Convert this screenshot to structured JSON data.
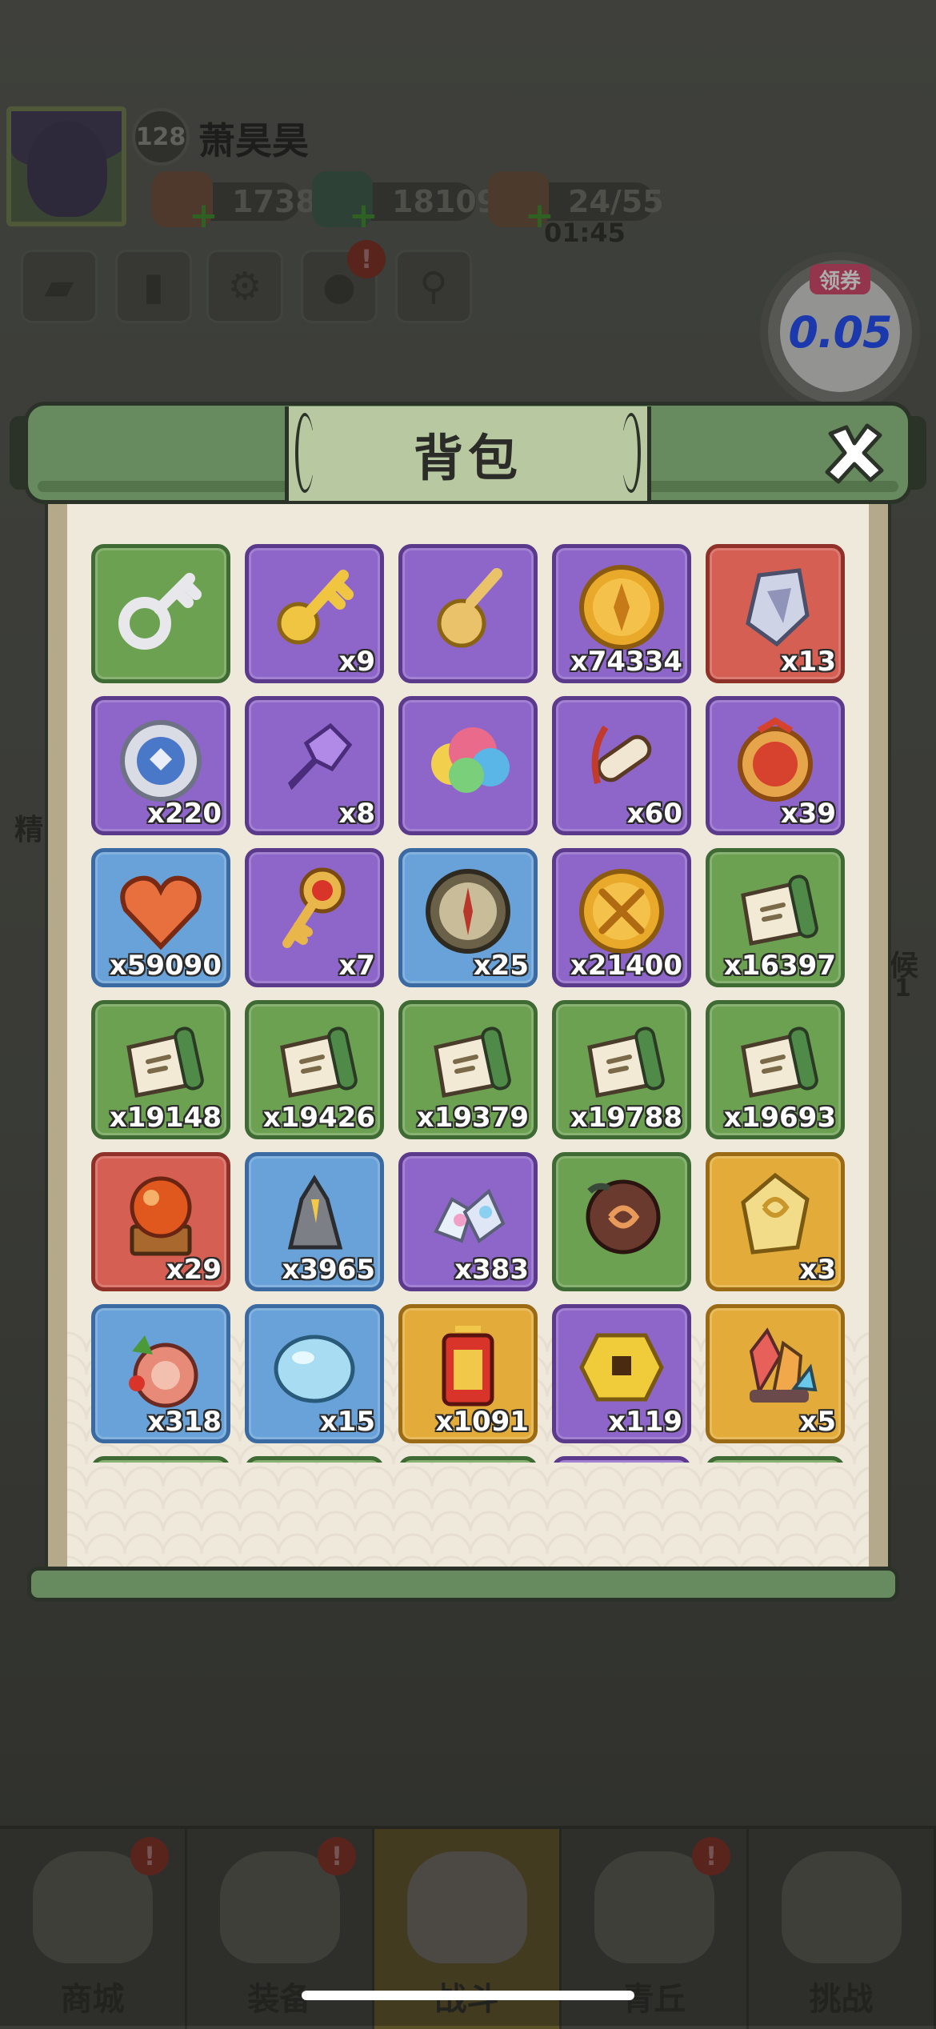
{
  "player": {
    "level": "128",
    "name": "萧昊昊"
  },
  "resources": {
    "tickets": "1738",
    "jade": "18109",
    "stamina": "24/55",
    "stamina_timer": "01:45"
  },
  "coupon": {
    "tag": "领券",
    "value": "0.05"
  },
  "side_labels": {
    "left": "精",
    "right": "候",
    "right_sub": "1"
  },
  "modal": {
    "title": "背包",
    "close_icon": "close-x-icon"
  },
  "items": [
    {
      "icon": "silver-key-icon",
      "color": "green",
      "qty": ""
    },
    {
      "icon": "gold-key-icon",
      "color": "purple",
      "qty": "x9"
    },
    {
      "icon": "gold-ornament-key-icon",
      "color": "purple",
      "qty": ""
    },
    {
      "icon": "gold-coin-icon",
      "color": "purple",
      "qty": "x74334"
    },
    {
      "icon": "crystal-shard-icon",
      "color": "red",
      "qty": "x13"
    },
    {
      "icon": "silver-medal-icon",
      "color": "purple",
      "qty": "x220"
    },
    {
      "icon": "purple-key-icon",
      "color": "purple",
      "qty": "x8"
    },
    {
      "icon": "rainbow-cloud-icon",
      "color": "purple",
      "qty": ""
    },
    {
      "icon": "scroll-tassel-icon",
      "color": "purple",
      "qty": "x60"
    },
    {
      "icon": "token-pouch-icon",
      "color": "purple",
      "qty": "x39"
    },
    {
      "icon": "heart-icon",
      "color": "blue",
      "qty": "x59090"
    },
    {
      "icon": "ruby-key-icon",
      "color": "purple",
      "qty": "x7"
    },
    {
      "icon": "compass-icon",
      "color": "blue",
      "qty": "x25"
    },
    {
      "icon": "battle-coin-icon",
      "color": "purple",
      "qty": "x21400"
    },
    {
      "icon": "scroll-icon",
      "color": "green",
      "qty": "x16397"
    },
    {
      "icon": "scroll-icon",
      "color": "green",
      "qty": "x19148"
    },
    {
      "icon": "scroll-icon",
      "color": "green",
      "qty": "x19426"
    },
    {
      "icon": "scroll-icon",
      "color": "green",
      "qty": "x19379"
    },
    {
      "icon": "scroll-icon",
      "color": "green",
      "qty": "x19788"
    },
    {
      "icon": "scroll-icon",
      "color": "green",
      "qty": "x19693"
    },
    {
      "icon": "crystal-ball-icon",
      "color": "red",
      "qty": "x29"
    },
    {
      "icon": "ore-crystal-icon",
      "color": "blue",
      "qty": "x3965"
    },
    {
      "icon": "gem-pile-icon",
      "color": "purple",
      "qty": "x383"
    },
    {
      "icon": "spirit-orb-icon",
      "color": "green",
      "qty": ""
    },
    {
      "icon": "dragon-jade-icon",
      "color": "gold",
      "qty": "x3"
    },
    {
      "icon": "meat-food-icon",
      "color": "blue",
      "qty": "x318"
    },
    {
      "icon": "water-stone-icon",
      "color": "blue",
      "qty": "x15"
    },
    {
      "icon": "points-banner-icon",
      "color": "gold",
      "qty": "x1091"
    },
    {
      "icon": "gold-tile-icon",
      "color": "purple",
      "qty": "x119"
    },
    {
      "icon": "rainbow-crystal-icon",
      "color": "gold",
      "qty": "x5"
    }
  ],
  "partial_row_colors": [
    "green",
    "green",
    "green",
    "purple",
    "green"
  ],
  "nav": [
    {
      "label": "商城",
      "icon": "shop-icon",
      "badge": "!"
    },
    {
      "label": "装备",
      "icon": "helmet-icon",
      "badge": "!"
    },
    {
      "label": "战斗",
      "icon": "crossed-swords-icon",
      "badge": ""
    },
    {
      "label": "青丘",
      "icon": "mountain-icon",
      "badge": "!"
    },
    {
      "label": "挑战",
      "icon": "challenge-icon",
      "badge": ""
    }
  ]
}
